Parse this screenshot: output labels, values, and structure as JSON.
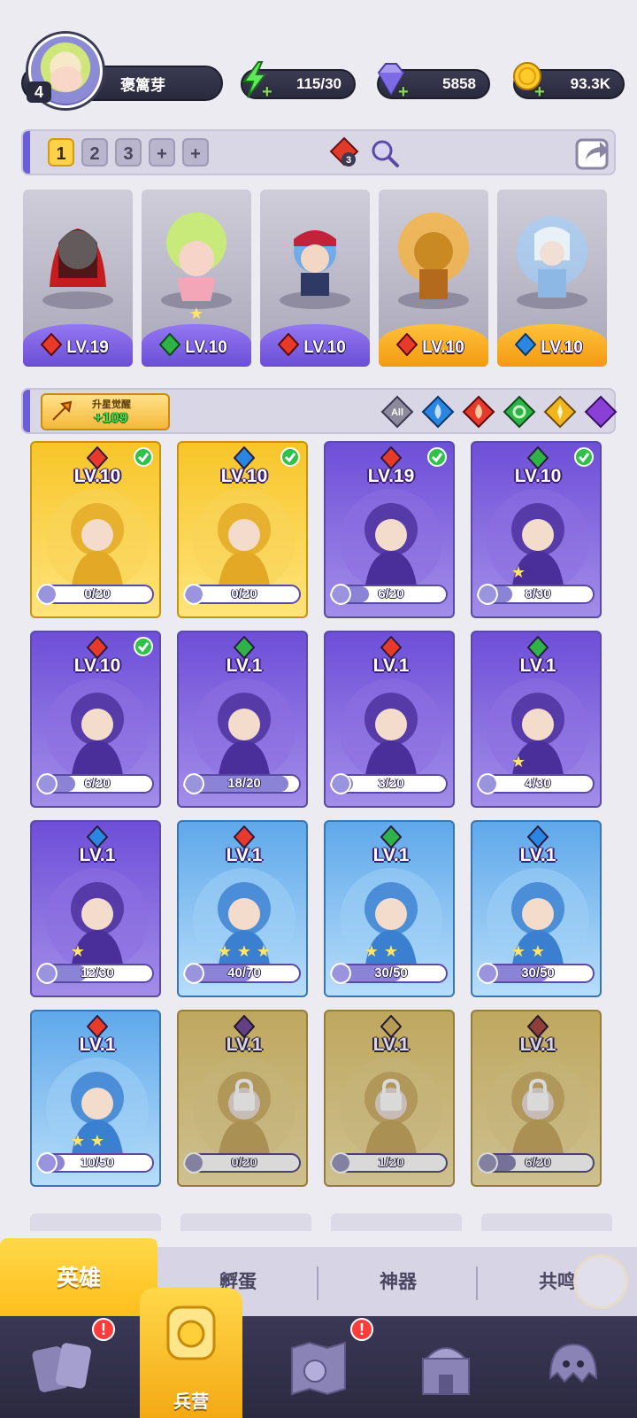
{
  "player": {
    "level": "4",
    "name": "褒篱芽"
  },
  "resources": {
    "energy": {
      "icon": "lightning-icon",
      "value": "115/30"
    },
    "gems": {
      "icon": "diamond-icon",
      "value": "5858"
    },
    "gold": {
      "icon": "coin-icon",
      "value": "93.3K"
    }
  },
  "team": {
    "tabs": [
      "1",
      "2",
      "3",
      "+",
      "+"
    ],
    "active_tab": "1",
    "cost_badge": "3",
    "cards": [
      {
        "element": "fire",
        "level": "LV.19",
        "band": "purple"
      },
      {
        "element": "nature",
        "level": "LV.10",
        "band": "purple"
      },
      {
        "element": "fire",
        "level": "LV.10",
        "band": "purple"
      },
      {
        "element": "fire",
        "level": "LV.10",
        "band": "gold"
      },
      {
        "element": "water",
        "level": "LV.10",
        "band": "gold"
      }
    ]
  },
  "filter": {
    "upgrade_title": "升星觉醒",
    "upgrade_value": "+109",
    "buttons": [
      "All",
      "water",
      "fire",
      "nature",
      "light",
      "dark"
    ]
  },
  "heroes": [
    {
      "level": "LV.10",
      "element": "fire",
      "progress": "0/20",
      "frac": 0.0,
      "theme": "gold",
      "check": true,
      "locked": false,
      "stars": 0
    },
    {
      "level": "LV.10",
      "element": "water",
      "progress": "0/20",
      "frac": 0.0,
      "theme": "gold",
      "check": true,
      "locked": false,
      "stars": 0
    },
    {
      "level": "LV.19",
      "element": "fire",
      "progress": "6/20",
      "frac": 0.3,
      "theme": "purple",
      "check": true,
      "locked": false,
      "stars": 0
    },
    {
      "level": "LV.10",
      "element": "nature",
      "progress": "8/30",
      "frac": 0.27,
      "theme": "purple",
      "check": true,
      "locked": false,
      "stars": 1
    },
    {
      "level": "LV.10",
      "element": "fire",
      "progress": "6/20",
      "frac": 0.3,
      "theme": "purple",
      "check": true,
      "locked": false,
      "stars": 0
    },
    {
      "level": "LV.1",
      "element": "nature",
      "progress": "18/20",
      "frac": 0.9,
      "theme": "purple",
      "check": false,
      "locked": false,
      "stars": 0
    },
    {
      "level": "LV.1",
      "element": "fire",
      "progress": "3/20",
      "frac": 0.15,
      "theme": "purple",
      "check": false,
      "locked": false,
      "stars": 0
    },
    {
      "level": "LV.1",
      "element": "nature",
      "progress": "4/30",
      "frac": 0.13,
      "theme": "purple",
      "check": false,
      "locked": false,
      "stars": 1
    },
    {
      "level": "LV.1",
      "element": "water",
      "progress": "12/30",
      "frac": 0.4,
      "theme": "purple",
      "check": false,
      "locked": false,
      "stars": 1
    },
    {
      "level": "LV.1",
      "element": "fire",
      "progress": "40/70",
      "frac": 0.57,
      "theme": "blue",
      "check": false,
      "locked": false,
      "stars": 3
    },
    {
      "level": "LV.1",
      "element": "nature",
      "progress": "30/50",
      "frac": 0.6,
      "theme": "blue",
      "check": false,
      "locked": false,
      "stars": 2
    },
    {
      "level": "LV.1",
      "element": "water",
      "progress": "30/50",
      "frac": 0.6,
      "theme": "blue",
      "check": false,
      "locked": false,
      "stars": 2
    },
    {
      "level": "LV.1",
      "element": "fire",
      "progress": "10/50",
      "frac": 0.2,
      "theme": "blue",
      "check": false,
      "locked": false,
      "stars": 2
    },
    {
      "level": "LV.1",
      "element": "dark",
      "progress": "0/20",
      "frac": 0.0,
      "theme": "gold",
      "check": false,
      "locked": true,
      "stars": 0
    },
    {
      "level": "LV.1",
      "element": "light",
      "progress": "1/20",
      "frac": 0.05,
      "theme": "gold",
      "check": false,
      "locked": true,
      "stars": 0
    },
    {
      "level": "LV.1",
      "element": "fire",
      "progress": "6/20",
      "frac": 0.3,
      "theme": "gold",
      "check": false,
      "locked": true,
      "stars": 0
    }
  ],
  "subtabs": [
    "英雄",
    "孵蛋",
    "神器",
    "共鸣"
  ],
  "active_subtab": "英雄",
  "nav": [
    {
      "icon": "cards-icon",
      "label": "",
      "badge": "!"
    },
    {
      "icon": "barracks-icon",
      "label": "兵营",
      "badge": ""
    },
    {
      "icon": "map-icon",
      "label": "",
      "badge": "!"
    },
    {
      "icon": "castle-icon",
      "label": "",
      "badge": ""
    },
    {
      "icon": "ghost-icon",
      "label": "",
      "badge": ""
    }
  ],
  "colors": {
    "fire": "#e83a2a",
    "water": "#2a86e0",
    "nature": "#2fb348",
    "light": "#f1b51e",
    "dark": "#8a3fd6",
    "accent": "#6c5ddb"
  }
}
